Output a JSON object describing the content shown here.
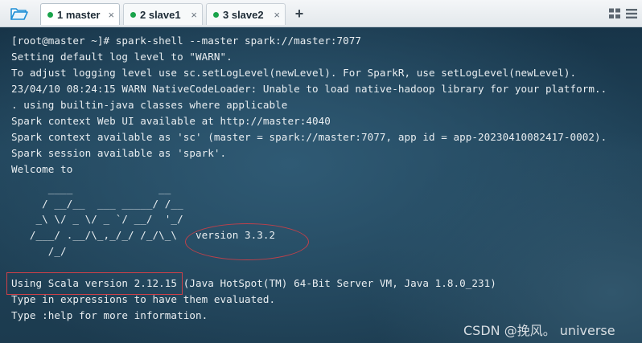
{
  "tabs": [
    {
      "label": "1 master",
      "close": "×",
      "status_color": "#19a34a",
      "active": true
    },
    {
      "label": "2 slave1",
      "close": "×",
      "status_color": "#19a34a",
      "active": false
    },
    {
      "label": "3 slave2",
      "close": "×",
      "status_color": "#19a34a",
      "active": false
    }
  ],
  "add_tab_label": "+",
  "icons": {
    "open": "folder-open-icon",
    "layout": "grid-layout-icon",
    "menu": "menu-icon"
  },
  "terminal": {
    "lines": [
      "[root@master ~]# spark-shell --master spark://master:7077",
      "Setting default log level to \"WARN\".",
      "To adjust logging level use sc.setLogLevel(newLevel). For SparkR, use setLogLevel(newLevel).",
      "23/04/10 08:24:15 WARN NativeCodeLoader: Unable to load native-hadoop library for your platform..",
      ". using builtin-java classes where applicable",
      "Spark context Web UI available at http://master:4040",
      "Spark context available as 'sc' (master = spark://master:7077, app id = app-20230410082417-0002).",
      "Spark session available as 'spark'.",
      "Welcome to"
    ],
    "banner": [
      "      ____              __",
      "     / __/__  ___ _____/ /__",
      "    _\\ \\/ _ \\/ _ `/ __/  '_/",
      "   /___/ .__/\\_,_/_/ /_/\\_\\   version 3.3.2",
      "      /_/"
    ],
    "scala_line": "Using Scala version 2.12.15 (Java HotSpot(TM) 64-Bit Server VM, Java 1.8.0_231)",
    "after": [
      "Type in expressions to have them evaluated.",
      "Type :help for more information."
    ]
  },
  "annotation_color": "#c0404a",
  "watermark": "CSDN @挽风。 universe"
}
